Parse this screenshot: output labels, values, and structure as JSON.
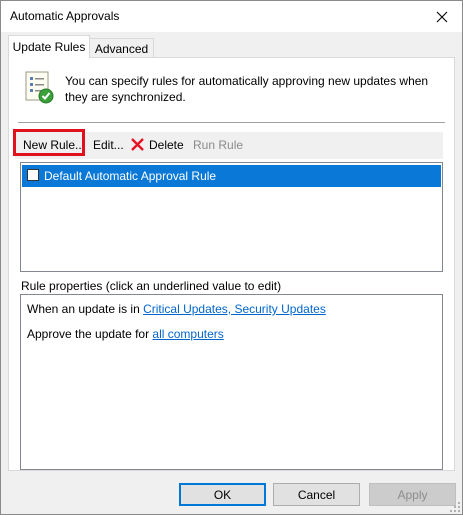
{
  "window": {
    "title": "Automatic Approvals"
  },
  "tabs": [
    {
      "label": "Update Rules",
      "active": true
    },
    {
      "label": "Advanced",
      "active": false
    }
  ],
  "info": {
    "icon": "checklist-approved-icon",
    "text": "You can specify rules for automatically approving new updates when they are synchronized."
  },
  "toolbar": {
    "new_rule_label": "New Rule...",
    "edit_label": "Edit...",
    "delete_label": "Delete",
    "run_rule_label": "Run Rule",
    "delete_icon": "red-x-icon"
  },
  "rules": [
    {
      "label": "Default Automatic Approval Rule",
      "checked": false,
      "selected": true
    }
  ],
  "properties": {
    "label": "Rule properties (click an underlined value to edit)",
    "line1_prefix": "When an update is in ",
    "line1_link": "Critical Updates, Security Updates",
    "line2_prefix": "Approve the update for ",
    "line2_link": "all computers"
  },
  "buttons": {
    "ok": "OK",
    "cancel": "Cancel",
    "apply": "Apply"
  },
  "colors": {
    "selection": "#0a78d7",
    "highlight_box": "#e0101d",
    "link": "#0066cc",
    "delete_icon": "#e81123",
    "accent_button_border": "#0078d7"
  }
}
